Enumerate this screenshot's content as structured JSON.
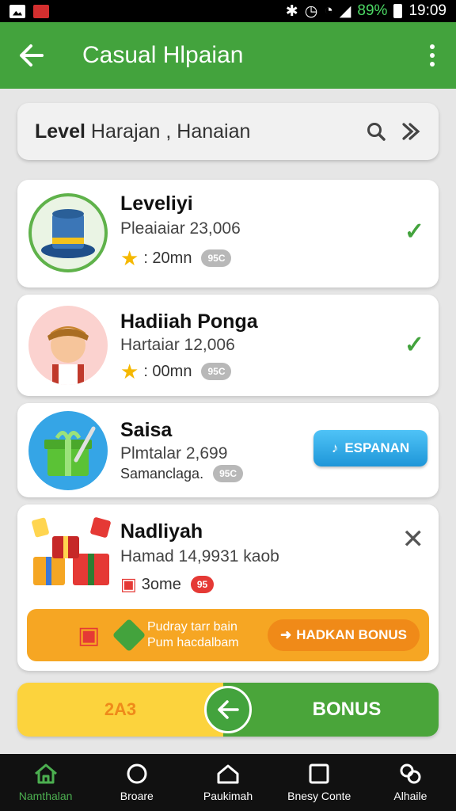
{
  "status_bar": {
    "battery_percent": "89%",
    "time": "19:09"
  },
  "app_bar": {
    "title": "Casual Hlpaian"
  },
  "search": {
    "bold_text": "Level",
    "text": " Harajan , Hanaian"
  },
  "cards": [
    {
      "title": "Leveliyi",
      "subtitle": "Pleaiaiar 23,006",
      "meta": ": 20mn",
      "pill": "95C"
    },
    {
      "title": "Hadiiah Ponga",
      "subtitle": "Hartaiar 12,006",
      "meta": ": 00mn",
      "pill": "95C"
    },
    {
      "title": "Saisa",
      "subtitle": "Plmtalar 2,699",
      "meta": "Samanclaga.",
      "pill": "95C",
      "button": "ESPANAN"
    },
    {
      "title": "Nadliyah",
      "subtitle": "Hamad 14,9931 kaob",
      "meta": "3ome",
      "pill": "95"
    }
  ],
  "promo": {
    "line1": "Pudray tarr bain",
    "line2": "Pum hacdalbam",
    "button": "HADKAN BONUS"
  },
  "bonus_bar": {
    "left_value": "2A3",
    "right_label": "BONUS"
  },
  "nav": [
    {
      "label": "Namthalan",
      "icon": "home-icon",
      "active": true
    },
    {
      "label": "Broare",
      "icon": "circle-icon",
      "active": false
    },
    {
      "label": "Paukimah",
      "icon": "house-icon",
      "active": false
    },
    {
      "label": "Bnesy Conte",
      "icon": "square-icon",
      "active": false
    },
    {
      "label": "Alhaile",
      "icon": "link-icon",
      "active": false
    }
  ],
  "colors": {
    "primary_green": "#43a33d",
    "accent_orange": "#f6a623",
    "accent_blue": "#1e96d8",
    "yellow": "#fcd33d"
  }
}
